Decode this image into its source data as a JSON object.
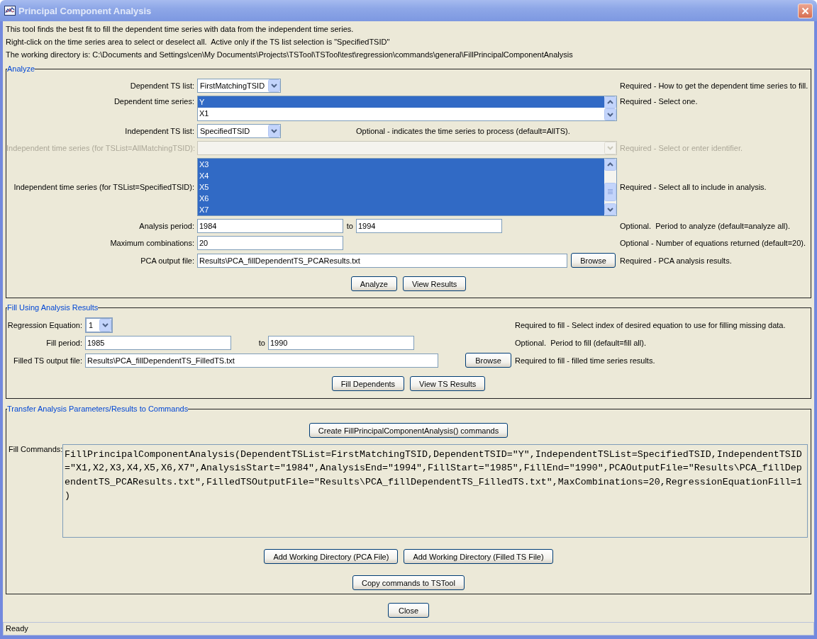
{
  "window": {
    "title": "Principal Component Analysis"
  },
  "intro": [
    "This tool finds the best fit to fill the dependent time series with data from the independent time series.",
    "Right-click on the time series area to select or deselect all.  Active only if the TS list selection is \"SpecifiedTSID\"",
    "The working directory is: C:\\Documents and Settings\\cen\\My Documents\\Projects\\TSTool\\TSTool\\test\\regression\\commands\\general\\FillPrincipalComponentAnalysis"
  ],
  "analyze": {
    "title": "Analyze",
    "rows": [
      {
        "kind": "choice",
        "label": "Dependent TS list:",
        "value": "FirstMatchingTSID",
        "disabled": false,
        "note": "Required - How to get the dependent time series to fill."
      },
      {
        "kind": "list_single",
        "label": "Dependent time series:",
        "items": [
          {
            "text": "Y",
            "selected": true
          },
          {
            "text": "X1",
            "selected": false
          }
        ],
        "disabled": false,
        "note": "Required - Select one."
      },
      {
        "kind": "choice_inline_note",
        "label": "Independent TS list:",
        "value": "SpecifiedTSID",
        "disabled": false,
        "note": "Optional - indicates the time series to process (default=AllTS)."
      },
      {
        "kind": "editable_choice",
        "label": "Independent time series (for TSList=AllMatchingTSID):",
        "disabled": true,
        "note": "Required - Select or enter identifier."
      },
      {
        "kind": "list_multi",
        "label": "Independent time series (for TSList=SpecifiedTSID):",
        "items": [
          {
            "text": "X3",
            "selected": true
          },
          {
            "text": "X4",
            "selected": true
          },
          {
            "text": "X5",
            "selected": true
          },
          {
            "text": "X6",
            "selected": true
          },
          {
            "text": "X7",
            "selected": true
          }
        ],
        "disabled": false,
        "note": "Required - Select all to include in analysis."
      },
      {
        "kind": "period",
        "label": "Analysis period:",
        "start": "1984",
        "to": "to",
        "end": "1994",
        "disabled": false,
        "note": "Optional.  Period to analyze (default=analyze all)."
      },
      {
        "kind": "text",
        "label": "Maximum combinations:",
        "value": "20",
        "disabled": false,
        "note": "Optional - Number of equations returned (default=20)."
      },
      {
        "kind": "file",
        "label": "PCA output file:",
        "value": "Results\\PCA_fillDependentTS_PCAResults.txt",
        "button": "Browse",
        "disabled": false,
        "note": "Required - PCA analysis results."
      }
    ],
    "buttons": [
      "Analyze",
      "View Results"
    ]
  },
  "fill": {
    "title": "Fill Using Analysis Results",
    "rows": [
      {
        "kind": "choice",
        "label": "Regression Equation:",
        "value": "1",
        "note": "Required to fill - Select index of desired equation to use for filling missing data."
      },
      {
        "kind": "period",
        "label": "Fill period:",
        "start": "1985",
        "to": "to",
        "end": "1990",
        "note": "Optional.  Period to fill (default=fill all)."
      },
      {
        "kind": "file",
        "label": "Filled TS output file:",
        "value": "Results\\PCA_fillDependentTS_FilledTS.txt",
        "button": "Browse",
        "note": "Required to fill - filled time series results."
      }
    ],
    "buttons": [
      "Fill Dependents",
      "View TS Results"
    ]
  },
  "transfer": {
    "title": "Transfer Analysis Parameters/Results to Commands",
    "create_button": "Create FillPrincipalComponentAnalysis() commands",
    "commands_label": "Fill Commands:",
    "commands": "FillPrincipalComponentAnalysis(DependentTSList=FirstMatchingTSID,DependentTSID=\"Y\",IndependentTSList=SpecifiedTSID,IndependentTSID=\"X1,X2,X3,X4,X5,X6,X7\",AnalysisStart=\"1984\",AnalysisEnd=\"1994\",FillStart=\"1985\",FillEnd=\"1990\",PCAOutputFile=\"Results\\PCA_fillDependentTS_PCAResults.txt\",FilledTSOutputFile=\"Results\\PCA_fillDependentTS_FilledTS.txt\",MaxCombinations=20,RegressionEquationFill=1)",
    "buttons": [
      "Add Working Directory (PCA File)",
      "Add Working Directory (Filled TS File)",
      "Copy commands to TSTool"
    ]
  },
  "close_button": "Close",
  "status_bar": "Ready"
}
